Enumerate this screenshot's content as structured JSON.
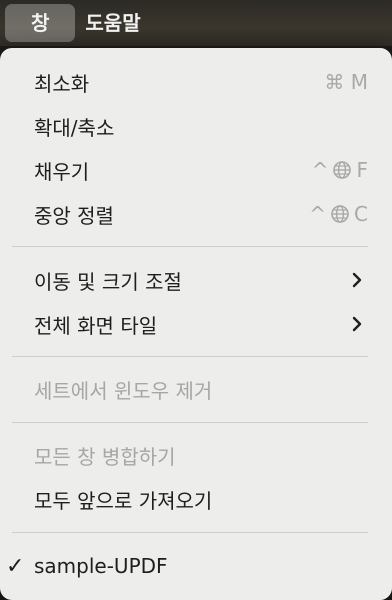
{
  "menubar": {
    "active_label": "창",
    "help_label": "도움말"
  },
  "menu": {
    "minimize": {
      "label": "최소화",
      "shortcut": "⌘ M"
    },
    "zoom": {
      "label": "확대/축소"
    },
    "fill": {
      "label": "채우기",
      "shortcut_key": "F"
    },
    "center": {
      "label": "중앙 정렬",
      "shortcut_key": "C"
    },
    "move_resize": {
      "label": "이동 및 크기 조절"
    },
    "fullscreen_tile": {
      "label": "전체 화면 타일"
    },
    "remove_from_set": {
      "label": "세트에서 윈도우 제거"
    },
    "merge_all": {
      "label": "모든 창 병합하기"
    },
    "bring_all_front": {
      "label": "모두 앞으로 가져오기"
    },
    "window_entry": {
      "label": "sample-UPDF",
      "checkmark": "✓"
    }
  }
}
